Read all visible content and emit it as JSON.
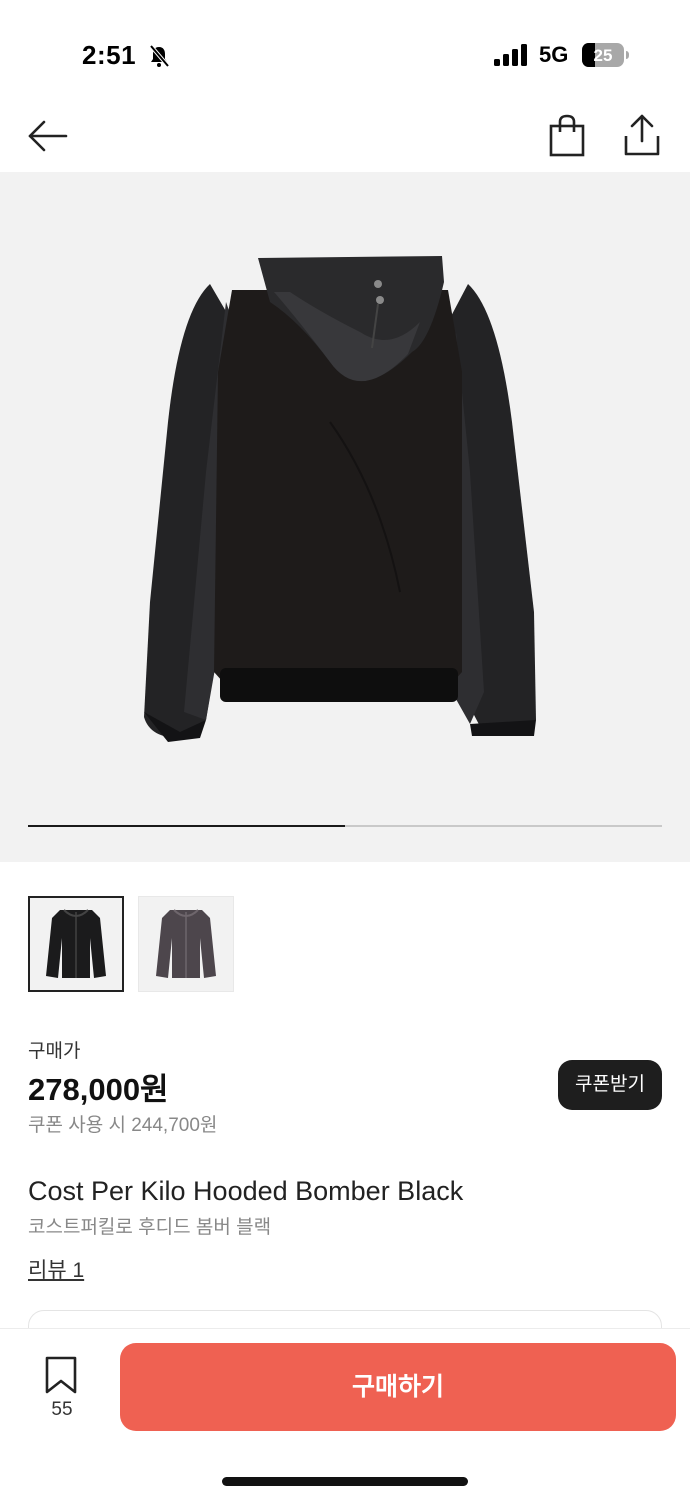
{
  "status_bar": {
    "time": "2:51",
    "network": "5G",
    "battery": "25"
  },
  "icons": {
    "back": "back-arrow-icon",
    "bag": "shopping-bag-icon",
    "share": "share-icon",
    "bookmark": "bookmark-icon"
  },
  "gallery": {
    "progress": 0.5
  },
  "price": {
    "label": "구매가",
    "value": "278,000원",
    "coupon_price": "쿠폰 사용 시 244,700원",
    "coupon_button": "쿠폰받기"
  },
  "product": {
    "name_en": "Cost Per Kilo Hooded Bomber Black",
    "name_ko": "코스트퍼킬로 후디드 봄버 블랙",
    "review_link": "리뷰 1"
  },
  "bottom_bar": {
    "wish_count": "55",
    "buy_label": "구매하기"
  },
  "colors": {
    "buy_button": "#ef6152",
    "coupon_button": "#1e1e1e"
  }
}
